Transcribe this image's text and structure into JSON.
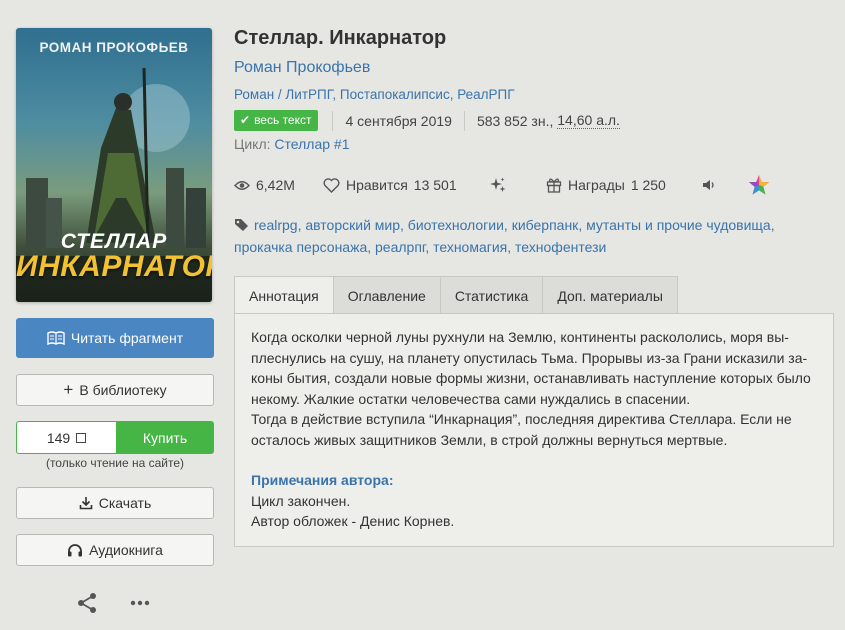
{
  "cover": {
    "author": "РОМАН ПРОКОФЬЕВ",
    "title_line1": "СТЕЛЛАР",
    "title_line2": "ИНКАРНАТОР"
  },
  "actions": {
    "read_label": "Читать фрагмент",
    "library_label": "В библиотеку",
    "price": "149",
    "buy_label": "Купить",
    "buy_note": "(только чтение на сайте)",
    "download_label": "Скачать",
    "audiobook_label": "Аудиокнига"
  },
  "book": {
    "title": "Стеллар. Инкарнатор",
    "author": "Роман Прокофьев",
    "genres": [
      "Роман / ЛитРПГ",
      "Постапокалипсис",
      "РеалРПГ"
    ],
    "status_badge": "весь текст",
    "date": "4 сентября 2019",
    "size_chars": "583 852 зн.,",
    "size_al": "14,60 а.л.",
    "cycle_label": "Цикл:",
    "cycle_name": "Стеллар",
    "cycle_number": "#1"
  },
  "stats": {
    "views": "6,42M",
    "likes_label": "Нравится",
    "likes": "13 501",
    "awards_label": "Награды",
    "awards": "1 250"
  },
  "tags": [
    "realrpg",
    "авторский мир",
    "биотехнологии",
    "киберпанк",
    "мутанты и прочие чудовища",
    "прокачка персонажа",
    "реалрпг",
    "техномагия",
    "технофентези"
  ],
  "tabs": [
    "Аннотация",
    "Оглавление",
    "Статистика",
    "Доп. материалы"
  ],
  "annotation": {
    "line1": "Когда осколки черной луны рухнули на Землю, континенты раскололись, моря вы-",
    "line2": "плеснулись на сушу, на планету опустилась Тьма. Прорывы из-за Грани исказили за-",
    "line3": "коны бытия, создали новые формы жизни, останавливать наступление которых было",
    "line4": "некому. Жалкие остатки человечества сами нуждались в спасении.",
    "line5": "Тогда в действие вступила “Инкарнация”, последняя директива Стеллара. Если не",
    "line6": "осталось живых защитников Земли, в строй должны вернуться мертвые.",
    "notes_title": "Примечания автора:",
    "note1": "Цикл закончен.",
    "note2": "Автор обложек - Денис Корнев."
  },
  "colors": {
    "accent": "#3a74ab",
    "read_button": "#4a86c2",
    "buy_green": "#45b545",
    "background": "#e6e6e3"
  }
}
